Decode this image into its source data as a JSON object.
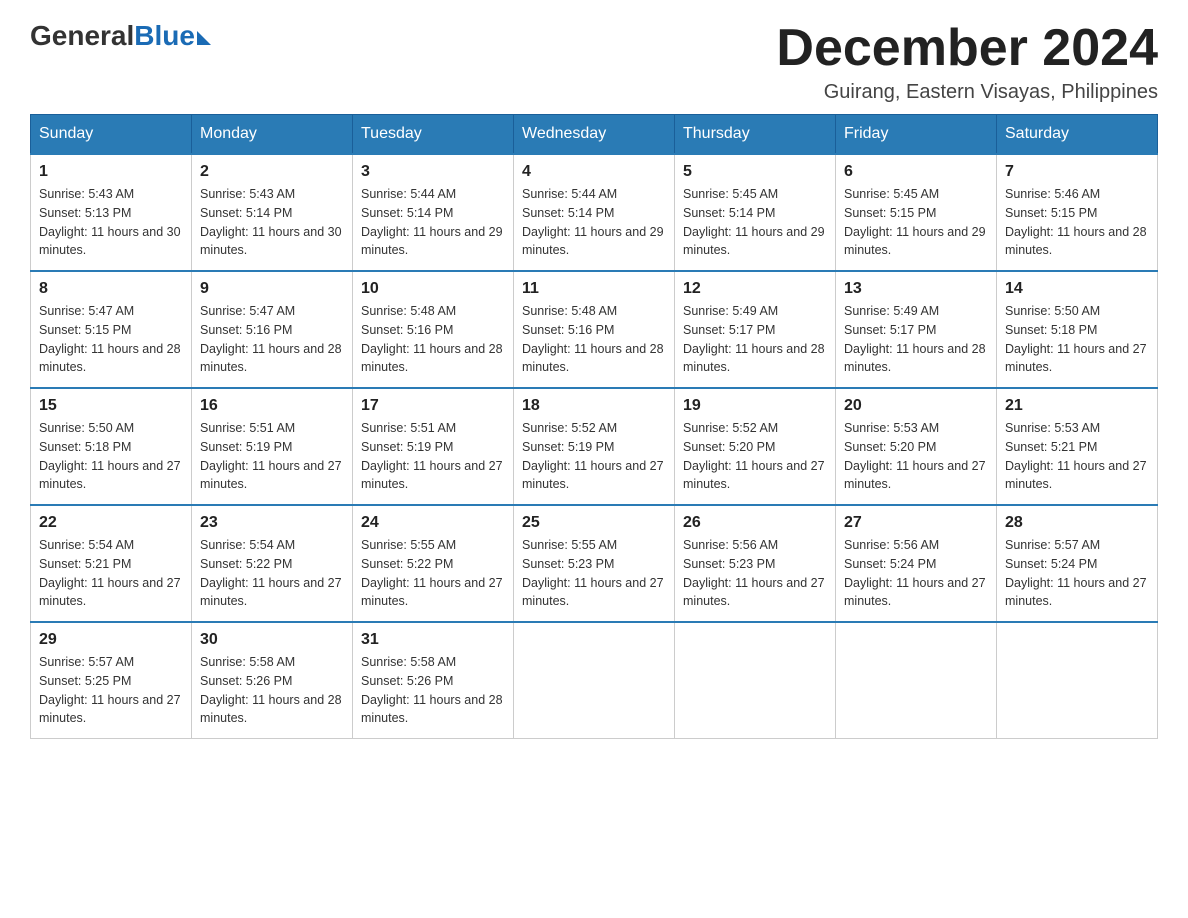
{
  "header": {
    "logo": {
      "general": "General",
      "blue": "Blue"
    },
    "title": "December 2024",
    "location": "Guirang, Eastern Visayas, Philippines"
  },
  "weekdays": [
    "Sunday",
    "Monday",
    "Tuesday",
    "Wednesday",
    "Thursday",
    "Friday",
    "Saturday"
  ],
  "weeks": [
    [
      {
        "day": "1",
        "sunrise": "5:43 AM",
        "sunset": "5:13 PM",
        "daylight": "11 hours and 30 minutes."
      },
      {
        "day": "2",
        "sunrise": "5:43 AM",
        "sunset": "5:14 PM",
        "daylight": "11 hours and 30 minutes."
      },
      {
        "day": "3",
        "sunrise": "5:44 AM",
        "sunset": "5:14 PM",
        "daylight": "11 hours and 29 minutes."
      },
      {
        "day": "4",
        "sunrise": "5:44 AM",
        "sunset": "5:14 PM",
        "daylight": "11 hours and 29 minutes."
      },
      {
        "day": "5",
        "sunrise": "5:45 AM",
        "sunset": "5:14 PM",
        "daylight": "11 hours and 29 minutes."
      },
      {
        "day": "6",
        "sunrise": "5:45 AM",
        "sunset": "5:15 PM",
        "daylight": "11 hours and 29 minutes."
      },
      {
        "day": "7",
        "sunrise": "5:46 AM",
        "sunset": "5:15 PM",
        "daylight": "11 hours and 28 minutes."
      }
    ],
    [
      {
        "day": "8",
        "sunrise": "5:47 AM",
        "sunset": "5:15 PM",
        "daylight": "11 hours and 28 minutes."
      },
      {
        "day": "9",
        "sunrise": "5:47 AM",
        "sunset": "5:16 PM",
        "daylight": "11 hours and 28 minutes."
      },
      {
        "day": "10",
        "sunrise": "5:48 AM",
        "sunset": "5:16 PM",
        "daylight": "11 hours and 28 minutes."
      },
      {
        "day": "11",
        "sunrise": "5:48 AM",
        "sunset": "5:16 PM",
        "daylight": "11 hours and 28 minutes."
      },
      {
        "day": "12",
        "sunrise": "5:49 AM",
        "sunset": "5:17 PM",
        "daylight": "11 hours and 28 minutes."
      },
      {
        "day": "13",
        "sunrise": "5:49 AM",
        "sunset": "5:17 PM",
        "daylight": "11 hours and 28 minutes."
      },
      {
        "day": "14",
        "sunrise": "5:50 AM",
        "sunset": "5:18 PM",
        "daylight": "11 hours and 27 minutes."
      }
    ],
    [
      {
        "day": "15",
        "sunrise": "5:50 AM",
        "sunset": "5:18 PM",
        "daylight": "11 hours and 27 minutes."
      },
      {
        "day": "16",
        "sunrise": "5:51 AM",
        "sunset": "5:19 PM",
        "daylight": "11 hours and 27 minutes."
      },
      {
        "day": "17",
        "sunrise": "5:51 AM",
        "sunset": "5:19 PM",
        "daylight": "11 hours and 27 minutes."
      },
      {
        "day": "18",
        "sunrise": "5:52 AM",
        "sunset": "5:19 PM",
        "daylight": "11 hours and 27 minutes."
      },
      {
        "day": "19",
        "sunrise": "5:52 AM",
        "sunset": "5:20 PM",
        "daylight": "11 hours and 27 minutes."
      },
      {
        "day": "20",
        "sunrise": "5:53 AM",
        "sunset": "5:20 PM",
        "daylight": "11 hours and 27 minutes."
      },
      {
        "day": "21",
        "sunrise": "5:53 AM",
        "sunset": "5:21 PM",
        "daylight": "11 hours and 27 minutes."
      }
    ],
    [
      {
        "day": "22",
        "sunrise": "5:54 AM",
        "sunset": "5:21 PM",
        "daylight": "11 hours and 27 minutes."
      },
      {
        "day": "23",
        "sunrise": "5:54 AM",
        "sunset": "5:22 PM",
        "daylight": "11 hours and 27 minutes."
      },
      {
        "day": "24",
        "sunrise": "5:55 AM",
        "sunset": "5:22 PM",
        "daylight": "11 hours and 27 minutes."
      },
      {
        "day": "25",
        "sunrise": "5:55 AM",
        "sunset": "5:23 PM",
        "daylight": "11 hours and 27 minutes."
      },
      {
        "day": "26",
        "sunrise": "5:56 AM",
        "sunset": "5:23 PM",
        "daylight": "11 hours and 27 minutes."
      },
      {
        "day": "27",
        "sunrise": "5:56 AM",
        "sunset": "5:24 PM",
        "daylight": "11 hours and 27 minutes."
      },
      {
        "day": "28",
        "sunrise": "5:57 AM",
        "sunset": "5:24 PM",
        "daylight": "11 hours and 27 minutes."
      }
    ],
    [
      {
        "day": "29",
        "sunrise": "5:57 AM",
        "sunset": "5:25 PM",
        "daylight": "11 hours and 27 minutes."
      },
      {
        "day": "30",
        "sunrise": "5:58 AM",
        "sunset": "5:26 PM",
        "daylight": "11 hours and 28 minutes."
      },
      {
        "day": "31",
        "sunrise": "5:58 AM",
        "sunset": "5:26 PM",
        "daylight": "11 hours and 28 minutes."
      },
      null,
      null,
      null,
      null
    ]
  ]
}
